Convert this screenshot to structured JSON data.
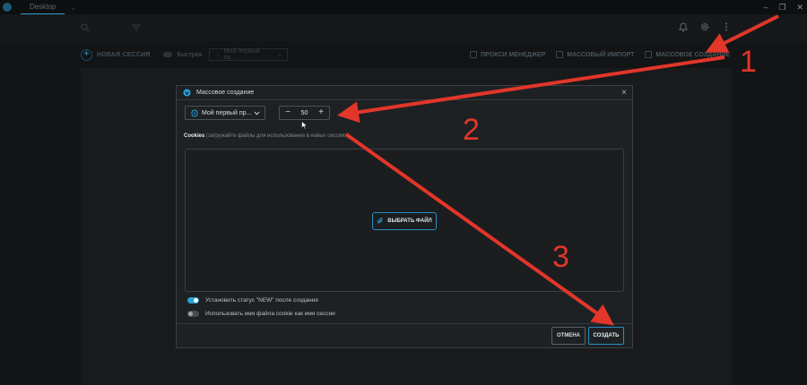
{
  "app": {
    "tab_label": "Desktop"
  },
  "window_controls": {
    "minimize": "–",
    "maximize": "❐",
    "close": "✕"
  },
  "toolbar": {
    "new_session": "НОВАЯ СЕССИЯ",
    "quick": "Быстрая",
    "profile_select": "Мой первый пр...",
    "links": [
      "ПРОКСИ МЕНЕДЖЕР",
      "МАССОВЫЙ ИМПОРТ",
      "МАССОВОЕ СОЗДАНИЕ"
    ]
  },
  "modal": {
    "title": "Массовое создание",
    "close": "×",
    "profile_dropdown": "Мой первый пр...",
    "stepper": {
      "minus": "−",
      "value": "50",
      "plus": "+"
    },
    "cookies_title": "Cookies",
    "cookies_hint": "(загружайте файлы для использования в новых сессиях)",
    "choose_file": "ВЫБРАТЬ ФАЙЛ",
    "options": [
      {
        "label": "Установить статус \"NEW\" после создания",
        "enabled": true
      },
      {
        "label": "Использовать имя файла cookie как имя сессии",
        "enabled": false
      }
    ],
    "cancel": "ОТМЕНА",
    "create": "СОЗДАТЬ"
  },
  "annotations": {
    "step_numbers": [
      "1",
      "2",
      "3"
    ],
    "color": "#e2362a"
  },
  "colors": {
    "accent": "#2a9fd6",
    "background": "#121415",
    "modal": "#1e2123"
  }
}
